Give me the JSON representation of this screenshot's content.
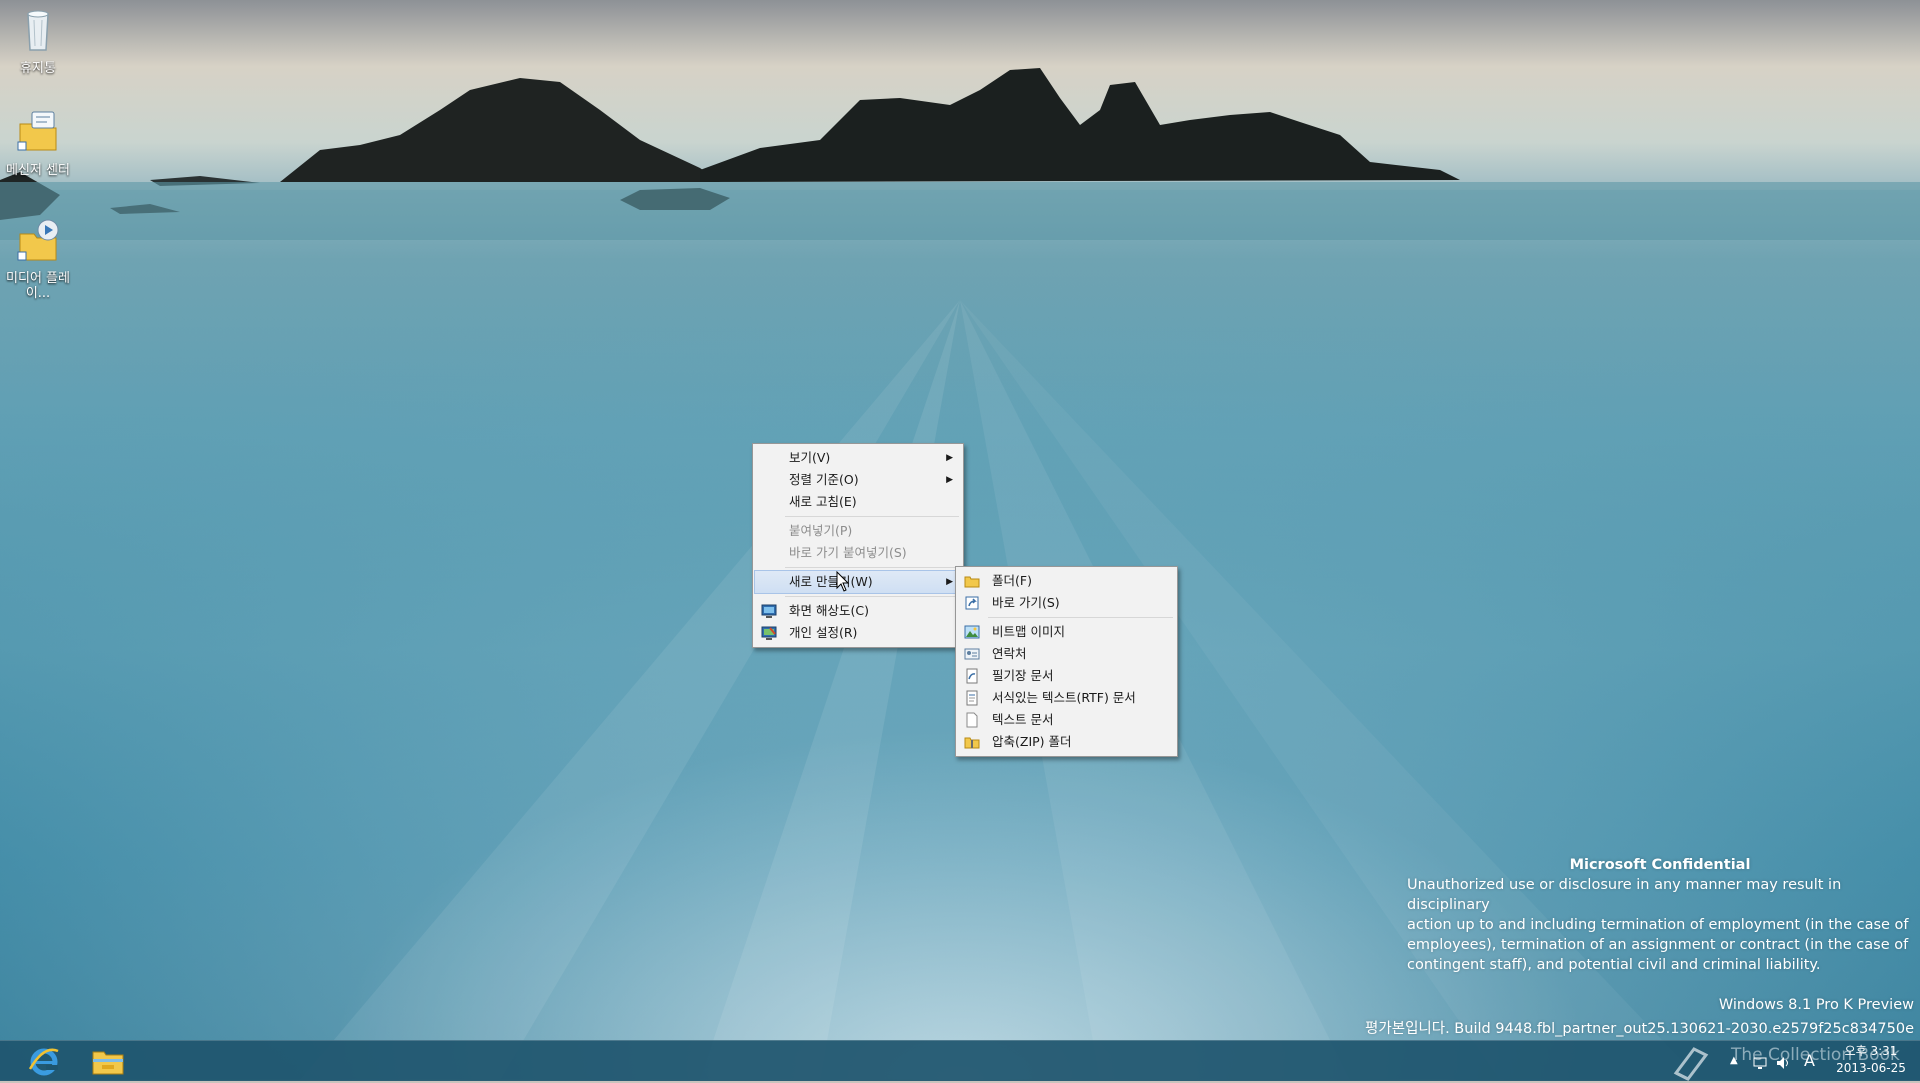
{
  "desktop": {
    "icons": [
      {
        "label": "휴지통",
        "icon": "recycle-bin-icon"
      },
      {
        "label": "메신저 센터",
        "icon": "messenger-center-icon"
      },
      {
        "label": "미디어 플레이...",
        "icon": "media-player-icon"
      }
    ]
  },
  "context_menu": {
    "items": {
      "view": "보기(V)",
      "sort": "정렬 기준(O)",
      "refresh": "새로 고침(E)",
      "paste": "붙여넣기(P)",
      "paste_shortcut": "바로 가기 붙여넣기(S)",
      "new": "새로 만들기(W)",
      "resolution": "화면 해상도(C)",
      "personalize": "개인 설정(R)"
    }
  },
  "submenu_new": {
    "items": {
      "folder": "폴더(F)",
      "shortcut": "바로 가기(S)",
      "bitmap": "비트맵 이미지",
      "contact": "연락처",
      "journal": "필기장 문서",
      "rtf": "서식있는 텍스트(RTF) 문서",
      "text": "텍스트 문서",
      "zip": "압축(ZIP) 폴더"
    }
  },
  "watermark": {
    "title": "Microsoft Confidential",
    "line1": "Unauthorized use or disclosure in any manner may result in disciplinary",
    "line2": "action up to and including termination of employment (in the case of",
    "line3": "employees), termination of an assignment or contract (in the case of",
    "line4": "contingent staff), and potential civil and criminal liability.",
    "edition": "Windows 8.1 Pro K Preview",
    "build": "평가본입니다. Build 9448.fbl_partner_out25.130621-2030.e2579f25c834750e"
  },
  "taskbar": {
    "pinned": [
      {
        "icon": "internet-explorer-icon"
      },
      {
        "icon": "file-explorer-icon"
      }
    ],
    "overlay_text": "The Collection Book",
    "ime": "A",
    "clock_time": "오후 3:31",
    "clock_date": "2013-06-25"
  },
  "colors": {
    "menu_bg": "#f2f2f2",
    "highlight": "#cfdff3",
    "taskbar": "#1e556e"
  }
}
